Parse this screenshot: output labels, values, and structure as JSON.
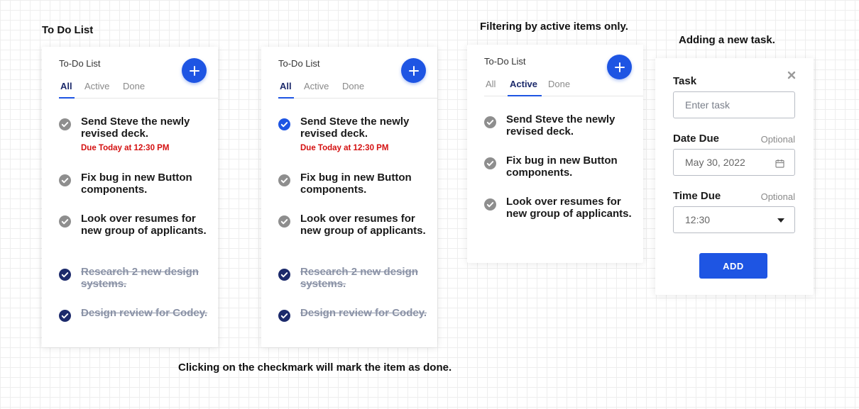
{
  "captions": {
    "todo_list": "To Do List",
    "filtering": "Filtering by active items only.",
    "adding": "Adding a new task.",
    "clicking": "Clicking on the checkmark will mark the item as done."
  },
  "card_title": "To-Do List",
  "tabs": [
    "All",
    "Active",
    "Done"
  ],
  "items": {
    "send_steve": "Send Steve the newly revised deck.",
    "due_today": "Due Today at 12:30 PM",
    "fix_bug": "Fix bug in new Button components.",
    "resumes": "Look over resumes for new group of applicants.",
    "research": "Research 2 new design systems.",
    "design_review": "Design review for Codey."
  },
  "form": {
    "task_label": "Task",
    "task_placeholder": "Enter task",
    "date_label": "Date Due",
    "date_optional": "Optional",
    "date_value": "May 30, 2022",
    "time_label": "Time Due",
    "time_optional": "Optional",
    "time_value": "12:30",
    "add_label": "ADD"
  },
  "icons": {
    "add": "plus-icon",
    "check": "check-circle-icon",
    "close": "close-icon",
    "calendar": "calendar-icon",
    "dropdown": "caret-down-icon"
  },
  "colors": {
    "accent": "#1e55e3",
    "done_check": "#1c2a6b",
    "pending_check": "#8e8e8e",
    "due_red": "#d41010"
  }
}
